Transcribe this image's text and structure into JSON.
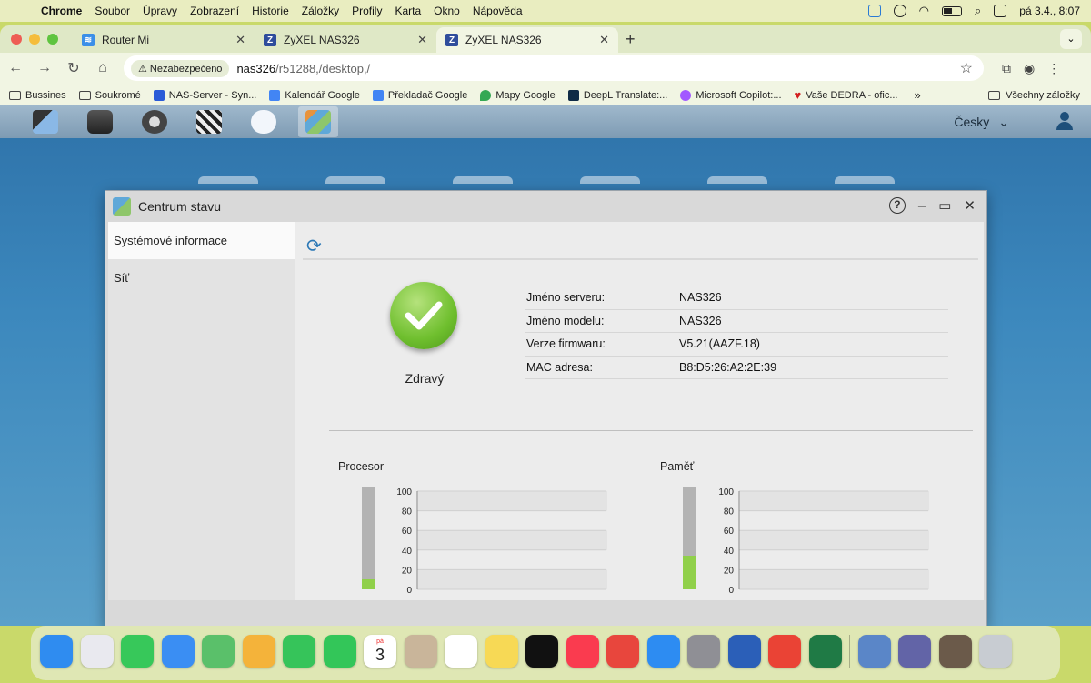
{
  "menubar": {
    "app": "Chrome",
    "items": [
      "Soubor",
      "Úpravy",
      "Zobrazení",
      "Historie",
      "Záložky",
      "Profily",
      "Karta",
      "Okno",
      "Nápověda"
    ],
    "datetime": "pá 3.4., 8:07"
  },
  "tabs": [
    {
      "title": "Router Mi",
      "active": false
    },
    {
      "title": "ZyXEL NAS326",
      "active": false
    },
    {
      "title": "ZyXEL NAS326",
      "active": true
    }
  ],
  "address": {
    "security_label": "Nezabezpečeno",
    "host": "nas326",
    "path": "/r51288,/desktop,/"
  },
  "bookmarks": [
    {
      "label": "Bussines",
      "type": "folder"
    },
    {
      "label": "Soukromé",
      "type": "folder"
    },
    {
      "label": "NAS-Server - Syn...",
      "type": "site",
      "color": "#2a5bd7"
    },
    {
      "label": "Kalendář Google",
      "type": "site",
      "color": "#4285f4"
    },
    {
      "label": "Překladač Google",
      "type": "site",
      "color": "#4285f4"
    },
    {
      "label": "Mapy Google",
      "type": "site",
      "color": "#34a853"
    },
    {
      "label": "DeepL Translate:...",
      "type": "site",
      "color": "#0f2b46"
    },
    {
      "label": "Microsoft Copilot:...",
      "type": "site",
      "color": "#a259ff"
    },
    {
      "label": "Vaše DEDRA - ofic...",
      "type": "site",
      "color": "#d21f1f"
    }
  ],
  "bookmarks_all": "Všechny záložky",
  "nas": {
    "language": "Česky",
    "window_title": "Centrum stavu",
    "sidebar": [
      "Systémové informace",
      "Síť"
    ],
    "health_label": "Zdravý",
    "info": [
      {
        "key": "Jméno serveru:",
        "value": "NAS326"
      },
      {
        "key": "Jméno modelu:",
        "value": "NAS326"
      },
      {
        "key": "Verze firmwaru:",
        "value": "V5.21(AAZF.18)"
      },
      {
        "key": "MAC adresa:",
        "value": "B8:D5:26:A2:2E:39"
      }
    ],
    "cpu_title": "Procesor",
    "mem_title": "Paměť",
    "cpu_level": 0.1,
    "mem_level": 0.33
  },
  "chart_data": [
    {
      "type": "bar",
      "title": "Procesor",
      "ylim": [
        0,
        100
      ],
      "yticks": [
        0,
        20,
        40,
        60,
        80,
        100
      ],
      "grid": true
    },
    {
      "type": "bar",
      "title": "Paměť",
      "ylim": [
        0,
        100
      ],
      "yticks": [
        0,
        20,
        40,
        60,
        80,
        100
      ],
      "grid": true
    }
  ],
  "dock": {
    "calendar_day": "3",
    "calendar_weekday": "pá"
  },
  "colors": {
    "accent": "#2b78b6",
    "health": "#6fbf2e",
    "meter_fill": "#90d04a"
  }
}
